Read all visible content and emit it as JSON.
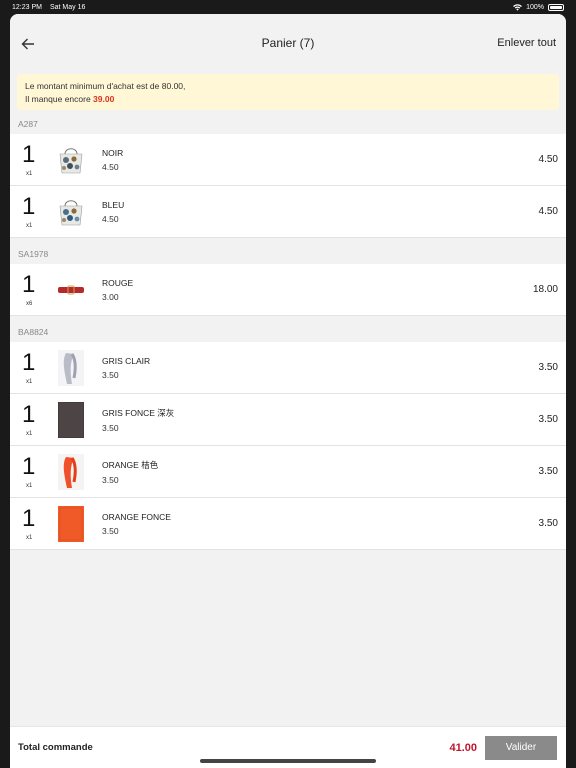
{
  "status_bar": {
    "time": "12:23 PM",
    "date": "Sat May 16",
    "battery": "100%"
  },
  "navbar": {
    "title": "Panier (7)",
    "right_action": "Enlever tout"
  },
  "notice": {
    "line1": "Le montant minimum d'achat est de 80.00,",
    "line2_prefix": "Il manque encore ",
    "missing_amount": "39.00"
  },
  "groups": [
    {
      "label": "A287",
      "items": [
        {
          "qty": "1",
          "mult": "x1",
          "name": "NOIR",
          "unit": "4.50",
          "price": "4.50"
        },
        {
          "qty": "1",
          "mult": "x1",
          "name": "BLEU",
          "unit": "4.50",
          "price": "4.50"
        }
      ]
    },
    {
      "label": "SA1978",
      "items": [
        {
          "qty": "1",
          "mult": "x6",
          "name": "ROUGE",
          "unit": "3.00",
          "price": "18.00"
        }
      ]
    },
    {
      "label": "BA8824",
      "items": [
        {
          "qty": "1",
          "mult": "x1",
          "name": "GRIS CLAIR",
          "unit": "3.50",
          "price": "3.50"
        },
        {
          "qty": "1",
          "mult": "x1",
          "name": "GRIS FONCE 深灰",
          "unit": "3.50",
          "price": "3.50"
        },
        {
          "qty": "1",
          "mult": "x1",
          "name": "ORANGE 桔色",
          "unit": "3.50",
          "price": "3.50"
        },
        {
          "qty": "1",
          "mult": "x1",
          "name": "ORANGE FONCE",
          "unit": "3.50",
          "price": "3.50"
        }
      ]
    }
  ],
  "footer": {
    "total_label": "Total commande",
    "total_amount": "41.00",
    "button_label": "Valider"
  },
  "colors": {
    "notice_bg": "#fff7d6",
    "accent_red": "#d8341f",
    "total_red": "#c0162c",
    "button_gray": "#8a8a8a"
  },
  "icons": {
    "back": "arrow-left-icon",
    "wifi": "wifi-icon",
    "battery": "battery-icon"
  }
}
